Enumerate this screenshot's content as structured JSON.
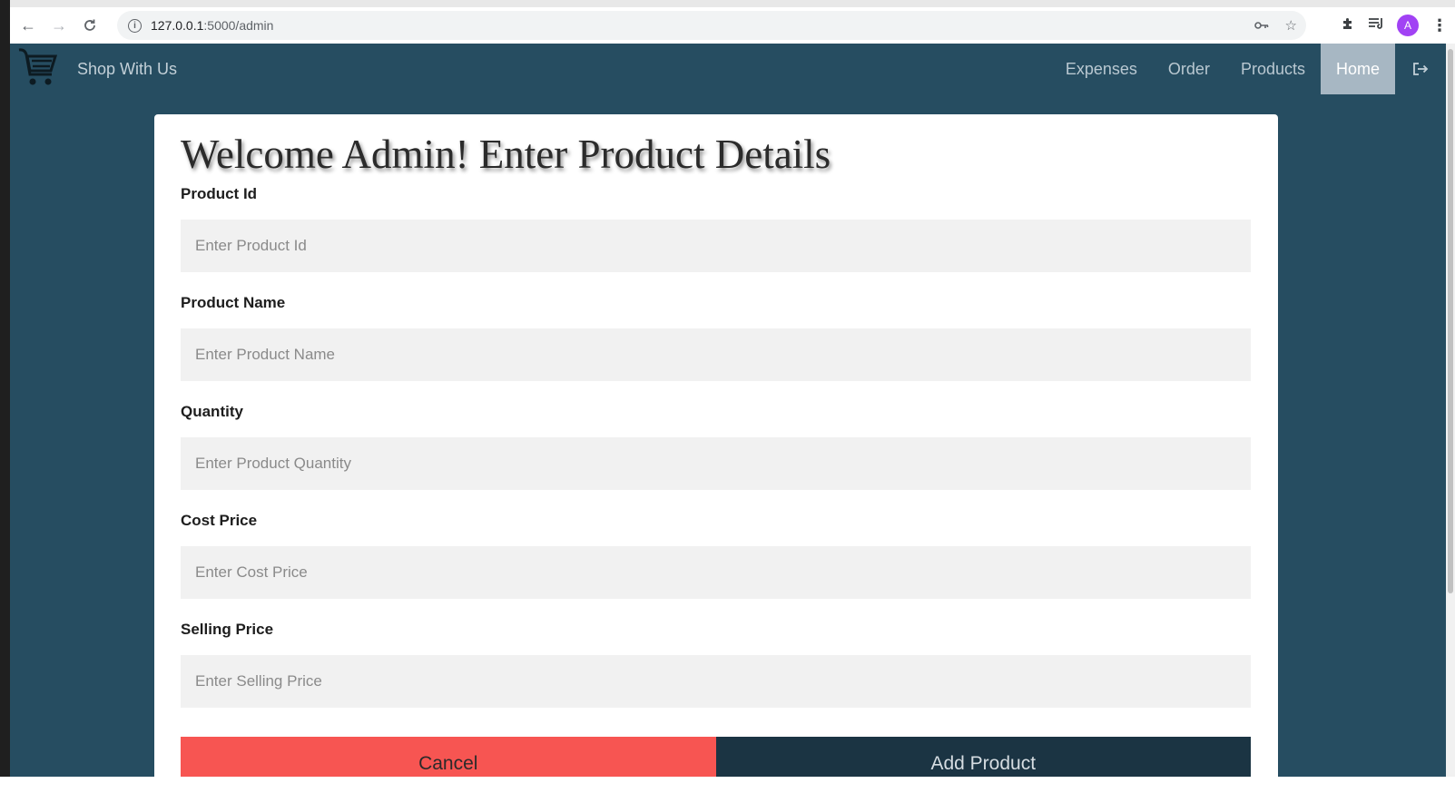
{
  "browser": {
    "url_host": "127.0.0.1",
    "url_path": ":5000/admin",
    "back_icon": "←",
    "forward_icon": "→",
    "reload_icon": "C",
    "info_icon": "i",
    "key_icon": "⚷",
    "star_icon": "☆",
    "extensions_icon": "✱",
    "queue_icon": "≡",
    "avatar_letter": "A",
    "menu_icon": "⋮"
  },
  "navbar": {
    "brand": "Shop With Us",
    "links": [
      "Expenses",
      "Order",
      "Products",
      "Home"
    ],
    "active_link": "Home",
    "colors": {
      "background": "#264d61",
      "active": "#a7b7c3"
    }
  },
  "form": {
    "title": "Welcome Admin! Enter Product Details",
    "fields": [
      {
        "label": "Product Id",
        "placeholder": "Enter Product Id"
      },
      {
        "label": "Product Name",
        "placeholder": "Enter Product Name"
      },
      {
        "label": "Quantity",
        "placeholder": "Enter Product Quantity"
      },
      {
        "label": "Cost Price",
        "placeholder": "Enter Cost Price"
      },
      {
        "label": "Selling Price",
        "placeholder": "Enter Selling Price"
      }
    ],
    "cancel_label": "Cancel",
    "submit_label": "Add Product",
    "colors": {
      "cancel": "#f75552",
      "submit": "#1b3443"
    }
  }
}
